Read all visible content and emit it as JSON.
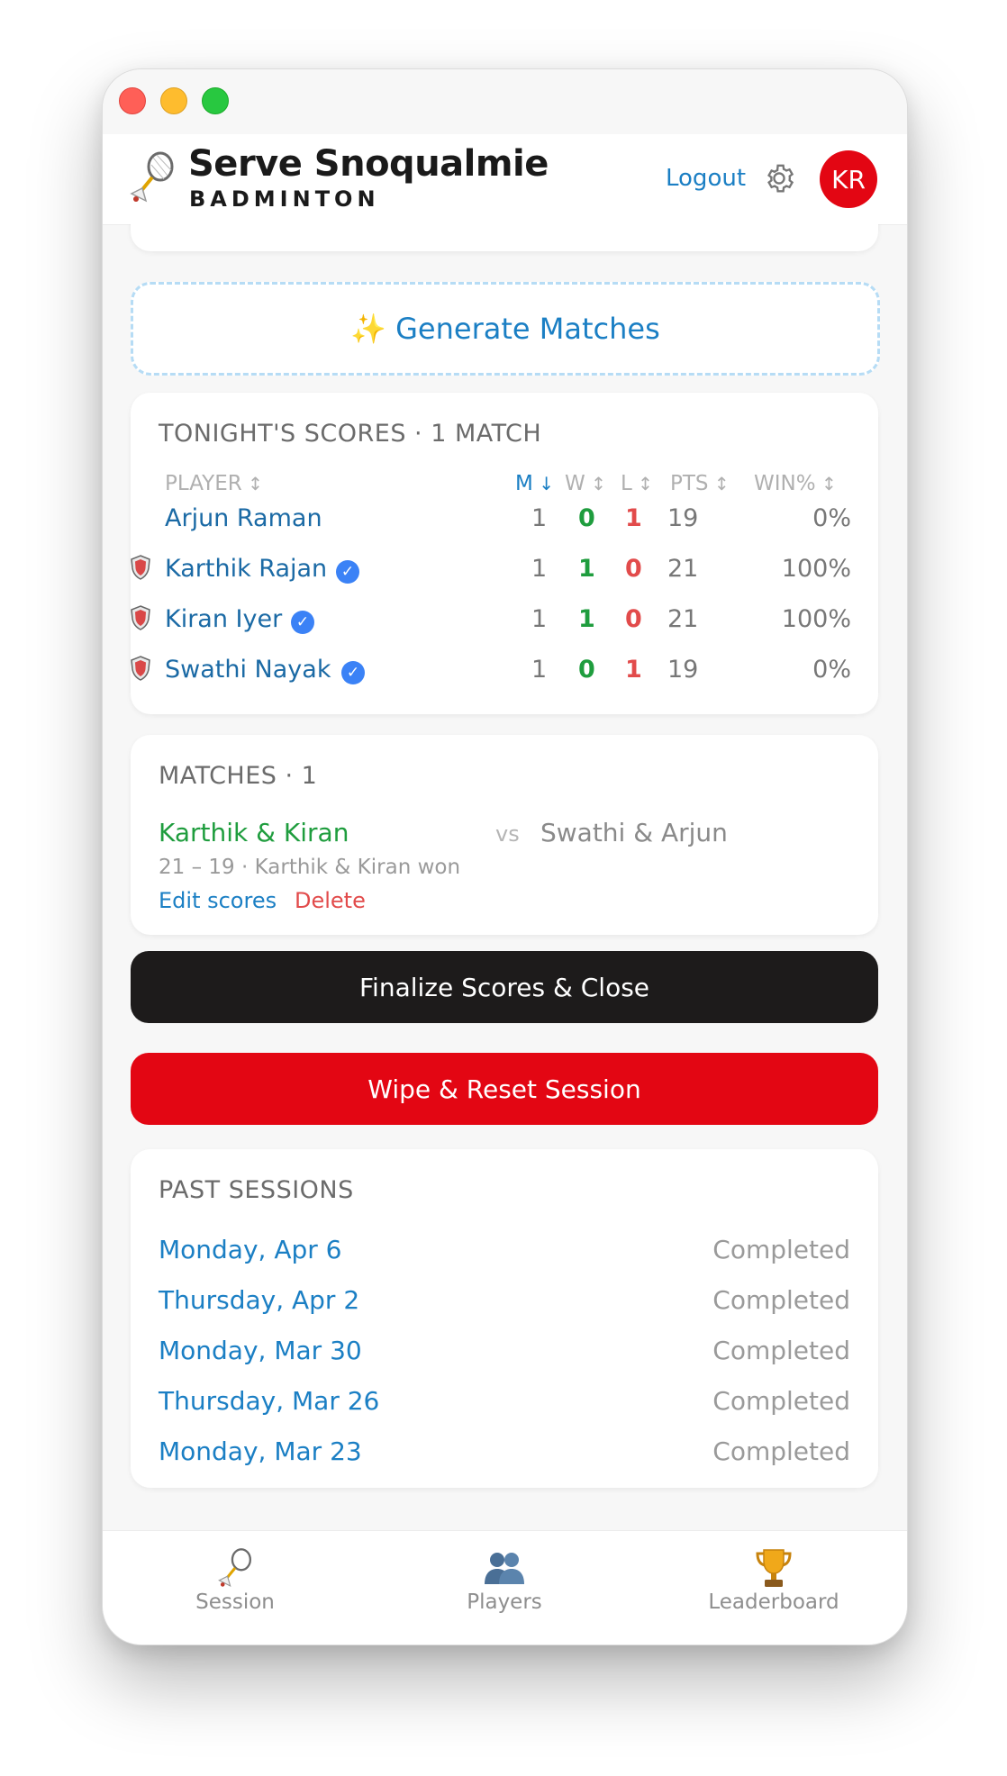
{
  "header": {
    "brand_title": "Serve Snoqualmie",
    "brand_subtitle": "BADMINTON",
    "logout_label": "Logout",
    "avatar_initials": "KR"
  },
  "actions": {
    "generate_label": "Generate Matches",
    "finalize_label": "Finalize Scores & Close",
    "wipe_label": "Wipe & Reset Session"
  },
  "scores": {
    "title": "TONIGHT'S SCORES · 1 MATCH",
    "columns": {
      "player": "PLAYER",
      "m": "M",
      "w": "W",
      "l": "L",
      "pts": "PTS",
      "winpct": "WIN%"
    },
    "rows": [
      {
        "name": "Arjun Raman",
        "m": "1",
        "w": "0",
        "l": "1",
        "pts": "19",
        "winpct": "0%"
      },
      {
        "name": "Karthik Rajan",
        "m": "1",
        "w": "1",
        "l": "0",
        "pts": "21",
        "winpct": "100%"
      },
      {
        "name": "Kiran Iyer",
        "m": "1",
        "w": "1",
        "l": "0",
        "pts": "21",
        "winpct": "100%"
      },
      {
        "name": "Swathi Nayak",
        "m": "1",
        "w": "0",
        "l": "1",
        "pts": "19",
        "winpct": "0%"
      }
    ]
  },
  "matches": {
    "title": "MATCHES · 1",
    "team_a": "Karthik & Kiran",
    "vs": "vs",
    "team_b": "Swathi & Arjun",
    "detail": "21 – 19 · Karthik & Kiran won",
    "edit_label": "Edit scores",
    "delete_label": "Delete"
  },
  "past": {
    "title": "PAST SESSIONS",
    "items": [
      {
        "date": "Monday, Apr 6",
        "status": "Completed"
      },
      {
        "date": "Thursday, Apr 2",
        "status": "Completed"
      },
      {
        "date": "Monday, Mar 30",
        "status": "Completed"
      },
      {
        "date": "Thursday, Mar 26",
        "status": "Completed"
      },
      {
        "date": "Monday, Mar 23",
        "status": "Completed"
      }
    ]
  },
  "tabs": [
    {
      "label": "Session",
      "icon": "badminton-icon"
    },
    {
      "label": "Players",
      "icon": "players-icon"
    },
    {
      "label": "Leaderboard",
      "icon": "trophy-icon"
    }
  ],
  "colors": {
    "accent_blue": "#1b7fc4",
    "win_green": "#1f9d3e",
    "loss_red": "#e24b4b",
    "brand_red": "#e30613",
    "dark_button": "#1d1b1b"
  }
}
